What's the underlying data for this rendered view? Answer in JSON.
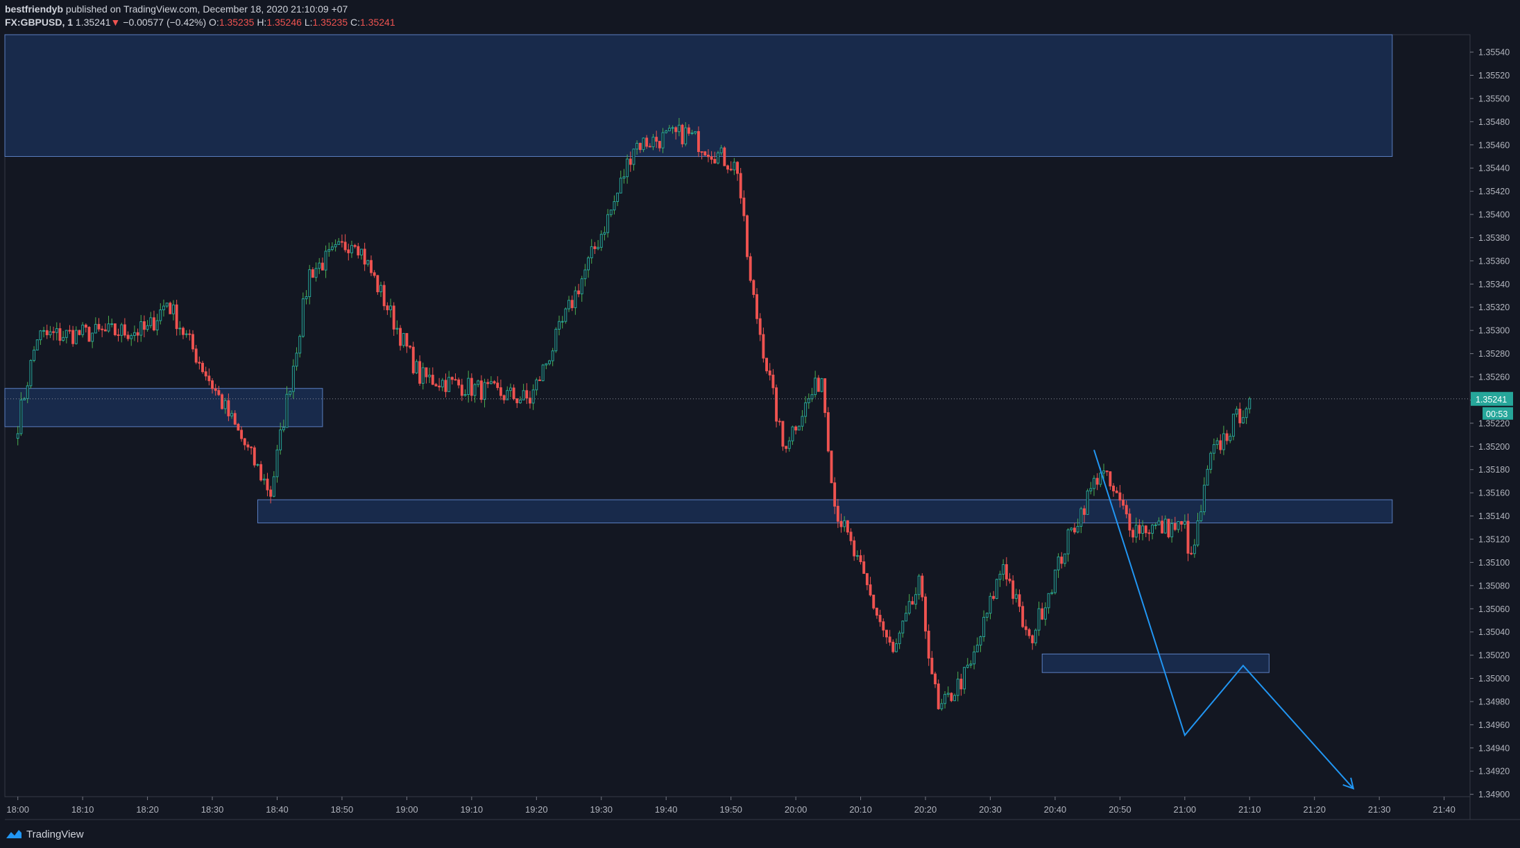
{
  "header": {
    "publisher": "bestfriendyb",
    "published_text": "published on TradingView.com, December 18, 2020 21:10:09 +07",
    "symbol": "FX:GBPUSD, 1",
    "last_price": "1.35241",
    "change_arrow": "▼",
    "change": "−0.00577 (−0.42%)",
    "o_label": "O:",
    "o_value": "1.35235",
    "h_label": "H:",
    "h_value": "1.35246",
    "l_label": "L:",
    "l_value": "1.35235",
    "c_label": "C:",
    "c_value": "1.35241"
  },
  "footer": {
    "brand": "TradingView"
  },
  "colors": {
    "background": "#131722",
    "up": "#26a69a",
    "up_wick": "#4caf50",
    "down": "#ef5350",
    "zone_fill": "#1e3a6e",
    "zone_stroke": "#5b7fc2",
    "arrow": "#2196f3",
    "price_tag": "#26a69a"
  },
  "chart_data": {
    "type": "candlestick",
    "symbol": "FX:GBPUSD",
    "interval": "1",
    "ylim": [
      1.34898,
      1.35555
    ],
    "y_ticks": [
      1.3554,
      1.3552,
      1.355,
      1.3548,
      1.3546,
      1.3544,
      1.3542,
      1.354,
      1.3538,
      1.3536,
      1.3534,
      1.3532,
      1.353,
      1.3528,
      1.3526,
      1.3524,
      1.3522,
      1.352,
      1.3518,
      1.3516,
      1.3514,
      1.3512,
      1.351,
      1.3508,
      1.3506,
      1.3504,
      1.3502,
      1.35,
      1.3498,
      1.3496,
      1.3494,
      1.3492,
      1.349
    ],
    "y_tick_labels": [
      "1.35540",
      "1.35520",
      "1.35500",
      "1.35480",
      "1.35460",
      "1.35440",
      "1.35420",
      "1.35400",
      "1.35380",
      "1.35360",
      "1.35340",
      "1.35320",
      "1.35300",
      "1.35280",
      "1.35260",
      "1.35240",
      "1.35220",
      "1.35200",
      "1.35180",
      "1.35160",
      "1.35140",
      "1.35120",
      "1.35100",
      "1.35080",
      "1.35060",
      "1.35040",
      "1.35020",
      "1.35000",
      "1.34980",
      "1.34960",
      "1.34940",
      "1.34920",
      "1.34900"
    ],
    "x_range_minutes": [
      1078,
      1304
    ],
    "x_ticks": [
      1080,
      1090,
      1100,
      1110,
      1120,
      1130,
      1140,
      1150,
      1160,
      1170,
      1180,
      1190,
      1200,
      1210,
      1220,
      1230,
      1240,
      1250,
      1260,
      1270,
      1280,
      1290,
      1300
    ],
    "x_tick_labels": [
      "18:00",
      "18:10",
      "18:20",
      "18:30",
      "18:40",
      "18:50",
      "19:00",
      "19:10",
      "19:20",
      "19:30",
      "19:40",
      "19:50",
      "20:00",
      "20:10",
      "20:20",
      "20:30",
      "20:40",
      "20:50",
      "21:00",
      "21:10",
      "21:20",
      "21:30",
      "21:40"
    ],
    "last_price": 1.35241,
    "last_price_label": "1.35241",
    "countdown_label": "00:53",
    "key_points": [
      {
        "time": "18:00",
        "close": 1.3522
      },
      {
        "time": "18:03",
        "close": 1.35295
      },
      {
        "time": "18:20",
        "close": 1.353
      },
      {
        "time": "18:23",
        "close": 1.35325
      },
      {
        "time": "18:39",
        "close": 1.3516
      },
      {
        "time": "18:45",
        "close": 1.3535
      },
      {
        "time": "18:52",
        "close": 1.3538
      },
      {
        "time": "19:02",
        "close": 1.3526
      },
      {
        "time": "19:19",
        "close": 1.3524
      },
      {
        "time": "19:32",
        "close": 1.3541
      },
      {
        "time": "19:35",
        "close": 1.3546
      },
      {
        "time": "19:43",
        "close": 1.3547
      },
      {
        "time": "19:51",
        "close": 1.3544
      },
      {
        "time": "19:53",
        "close": 1.3534
      },
      {
        "time": "19:58",
        "close": 1.352
      },
      {
        "time": "20:04",
        "close": 1.3526
      },
      {
        "time": "20:06",
        "close": 1.3515
      },
      {
        "time": "20:15",
        "close": 1.3502
      },
      {
        "time": "20:19",
        "close": 1.3508
      },
      {
        "time": "20:22",
        "close": 1.3497
      },
      {
        "time": "20:27",
        "close": 1.3501
      },
      {
        "time": "20:32",
        "close": 1.351
      },
      {
        "time": "20:36",
        "close": 1.3503
      },
      {
        "time": "20:42",
        "close": 1.3512
      },
      {
        "time": "20:47",
        "close": 1.3518
      },
      {
        "time": "20:52",
        "close": 1.3513
      },
      {
        "time": "21:00",
        "close": 1.3513
      },
      {
        "time": "21:01",
        "close": 1.351
      },
      {
        "time": "21:04",
        "close": 1.3519
      },
      {
        "time": "21:10",
        "close": 1.35241
      }
    ],
    "zones": [
      {
        "t0": 1078,
        "t1": 1292,
        "p_low": 1.3545,
        "p_high": 1.35555
      },
      {
        "t0": 1078,
        "t1": 1127,
        "p_low": 1.35217,
        "p_high": 1.3525
      },
      {
        "t0": 1117,
        "t1": 1292,
        "p_low": 1.35134,
        "p_high": 1.35154
      },
      {
        "t0": 1238,
        "t1": 1273,
        "p_low": 1.35005,
        "p_high": 1.35021
      }
    ],
    "projection_path": [
      {
        "t": 1246,
        "p": 1.35197
      },
      {
        "t": 1260,
        "p": 1.34951
      },
      {
        "t": 1269,
        "p": 1.35011
      },
      {
        "t": 1286,
        "p": 1.34905
      }
    ]
  }
}
